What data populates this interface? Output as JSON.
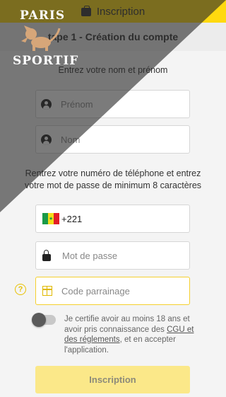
{
  "header": {
    "title": "Inscription"
  },
  "step": {
    "title": "Étape 1 - Création du compte",
    "visible_title": "tape 1 - Création du compte"
  },
  "name_section": {
    "label": "Entrez votre nom et prénom",
    "first_name_placeholder": "Prénom",
    "last_name_placeholder": "Nom"
  },
  "credentials_section": {
    "label_line1": "Rentrez votre numéro de téléphone et entrez",
    "label_line2": "votre mot de passe de minimum 8 caractères",
    "phone_prefix": "+221",
    "password_placeholder": "Mot de passe",
    "referral_placeholder": "Code parrainage"
  },
  "consent": {
    "text_before": "Je certifie avoir au moins 18 ans et avoir pris connaissance des ",
    "link_text": "CGU et des réglements",
    "text_after": ", et en accepter l'application.",
    "checked": false
  },
  "submit": {
    "label": "Inscription"
  },
  "watermark": {
    "line1": "PARIS",
    "line2": "SPORTIF"
  },
  "colors": {
    "accent": "#ffd90f",
    "button_disabled": "#fbe889",
    "referral_border": "#f5d02e"
  },
  "icons": [
    "shopping-bag-icon",
    "user-icon",
    "senegal-flag-icon",
    "lock-icon",
    "help-icon",
    "gift-icon",
    "lion-logo-icon"
  ]
}
